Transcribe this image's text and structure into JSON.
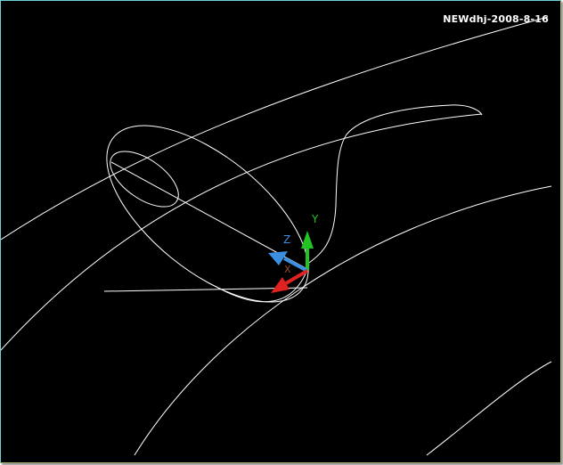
{
  "viewport": {
    "watermark_text": "NEWdhj-2008-8-16",
    "background_color": "#000000",
    "line_color": "#ffffff"
  },
  "ucs_icon": {
    "x_label": "X",
    "y_label": "Y",
    "z_label": "Z",
    "x_color": "#e02222",
    "y_color": "#22c322",
    "z_color": "#3a8fe0"
  }
}
